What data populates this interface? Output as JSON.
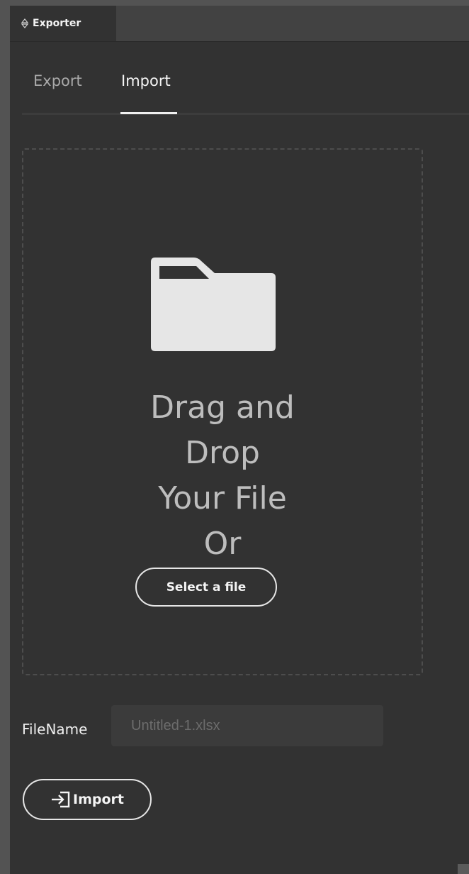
{
  "panel": {
    "title": "Exporter",
    "grip_icon": "updown-grip-icon"
  },
  "tabs": [
    {
      "label": "Export",
      "active": false
    },
    {
      "label": "Import",
      "active": true
    }
  ],
  "dropzone": {
    "icon": "folder-icon",
    "text": "Drag and\nDrop\nYour File\nOr",
    "select_button_label": "Select a file"
  },
  "filename": {
    "label": "FileName",
    "placeholder": "Untitled-1.xlsx",
    "value": ""
  },
  "import_button": {
    "label": "Import",
    "icon": "sign-in-icon"
  },
  "colors": {
    "panel_bg": "#323232",
    "header_bg": "#424242",
    "text_primary": "#f4f4f4",
    "text_muted": "#a9a9a9"
  }
}
